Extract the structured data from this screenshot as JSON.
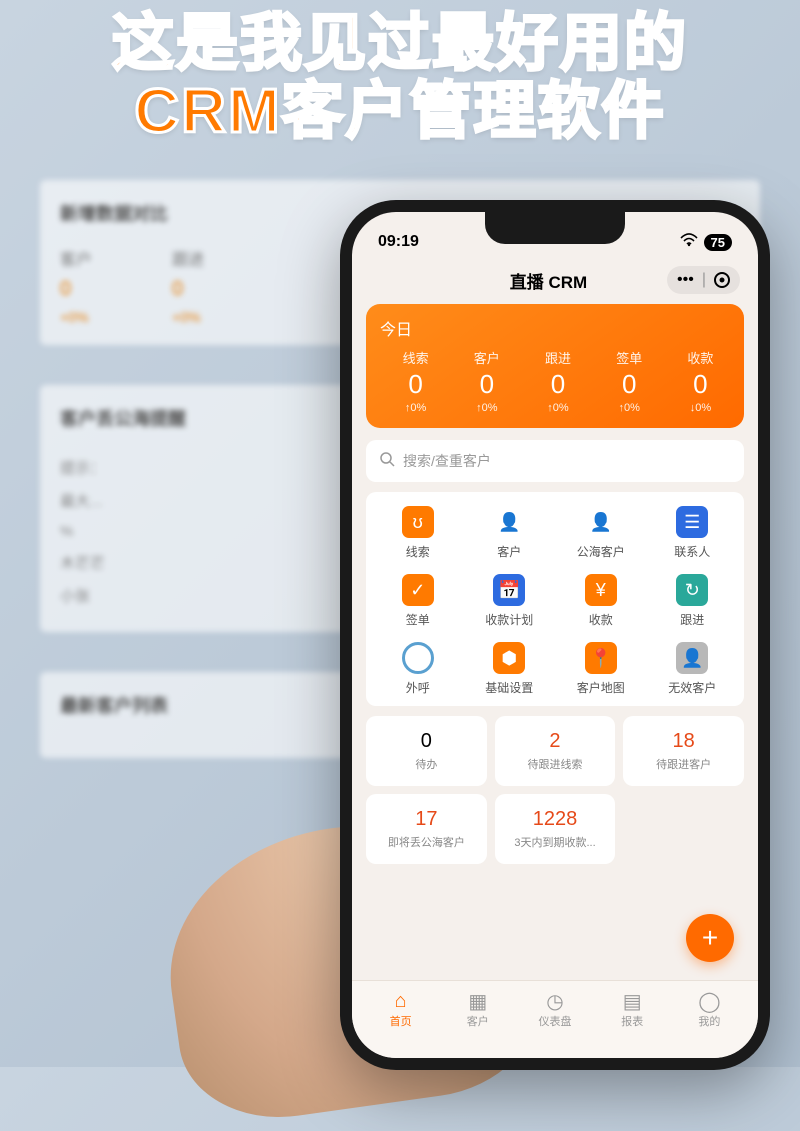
{
  "headline_line1": "这是我见过最好用的",
  "headline_line2": "CRM客户管理软件",
  "background": {
    "panel1_title": "新增数据对比",
    "metric1_label": "客户",
    "metric1_value": "0",
    "metric1_pct": "+0%",
    "metric2_label": "跟进",
    "metric2_value": "0",
    "metric2_pct": "+0%",
    "panel2_title": "客户丢公海提醒",
    "list_items": [
      "提示：",
      "最大...",
      "%",
      "木芒芒",
      "小张"
    ],
    "panel3_title": "最新客户列表"
  },
  "status": {
    "time": "09:19",
    "battery": "75"
  },
  "app_title": "直播 CRM",
  "today": {
    "label": "今日",
    "cols": [
      {
        "head": "线索",
        "val": "0",
        "pct": "↑0%"
      },
      {
        "head": "客户",
        "val": "0",
        "pct": "↑0%"
      },
      {
        "head": "跟进",
        "val": "0",
        "pct": "↑0%"
      },
      {
        "head": "签单",
        "val": "0",
        "pct": "↑0%"
      },
      {
        "head": "收款",
        "val": "0",
        "pct": "↓0%"
      }
    ]
  },
  "search_placeholder": "搜索/查重客户",
  "menu": [
    {
      "label": "线索"
    },
    {
      "label": "客户"
    },
    {
      "label": "公海客户"
    },
    {
      "label": "联系人"
    },
    {
      "label": "签单"
    },
    {
      "label": "收款计划"
    },
    {
      "label": "收款"
    },
    {
      "label": "跟进"
    },
    {
      "label": "外呼"
    },
    {
      "label": "基础设置"
    },
    {
      "label": "客户地图"
    },
    {
      "label": "无效客户"
    }
  ],
  "stats": [
    {
      "val": "0",
      "label": "待办",
      "red": false
    },
    {
      "val": "2",
      "label": "待跟进线索",
      "red": true
    },
    {
      "val": "18",
      "label": "待跟进客户",
      "red": true
    },
    {
      "val": "17",
      "label": "即将丢公海客户",
      "red": true
    },
    {
      "val": "1228",
      "label": "3天内到期收款...",
      "red": true
    }
  ],
  "tabs": [
    {
      "label": "首页",
      "active": true
    },
    {
      "label": "客户",
      "active": false
    },
    {
      "label": "仪表盘",
      "active": false
    },
    {
      "label": "报表",
      "active": false
    },
    {
      "label": "我的",
      "active": false
    }
  ]
}
